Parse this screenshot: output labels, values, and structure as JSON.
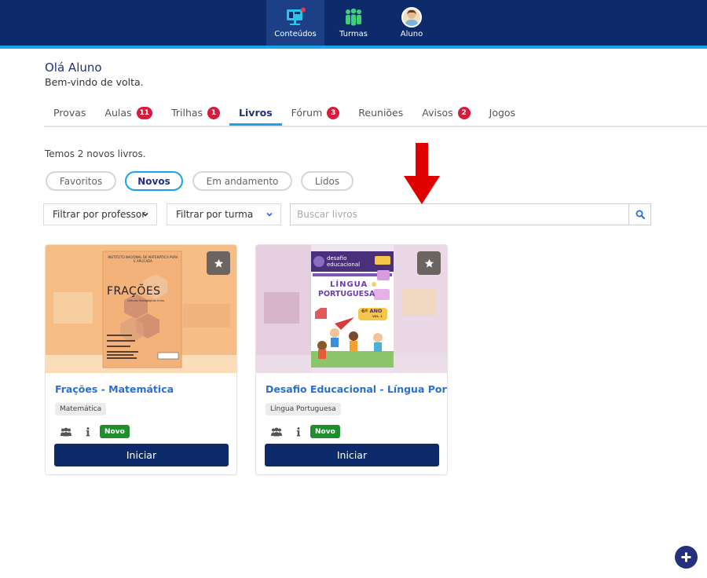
{
  "topnav": {
    "items": [
      {
        "label": "Conteúdos",
        "icon": "monitor-icon",
        "active": true
      },
      {
        "label": "Turmas",
        "icon": "group-icon",
        "active": false
      },
      {
        "label": "Aluno",
        "icon": "avatar",
        "active": false
      }
    ]
  },
  "greeting": {
    "title": "Olá Aluno",
    "subtitle": "Bem-vindo de volta."
  },
  "tabs": [
    {
      "label": "Provas",
      "badge": null
    },
    {
      "label": "Aulas",
      "badge": "11"
    },
    {
      "label": "Trilhas",
      "badge": "1"
    },
    {
      "label": "Livros",
      "badge": null,
      "active": true
    },
    {
      "label": "Fórum",
      "badge": "3"
    },
    {
      "label": "Reuniões",
      "badge": null
    },
    {
      "label": "Avisos",
      "badge": "2"
    },
    {
      "label": "Jogos",
      "badge": null
    }
  ],
  "news_text": "Temos 2 novos livros.",
  "filters": {
    "chips": [
      {
        "label": "Favoritos",
        "selected": false
      },
      {
        "label": "Novos",
        "selected": true
      },
      {
        "label": "Em andamento",
        "selected": false
      },
      {
        "label": "Lidos",
        "selected": false
      }
    ],
    "professor": "Filtrar por professor",
    "turma": "Filtrar por turma",
    "search_placeholder": "Buscar livros"
  },
  "books": [
    {
      "title": "Frações - Matemática",
      "tag": "Matemática",
      "status": "Novo",
      "button": "Iniciar",
      "cover": {
        "header": "INSTITUTO NACIONAL DE MATEMÁTICA PURA E APLICADA",
        "title": "FRAÇÕES",
        "subtitle": "Leituras Pedagógicas Impa"
      }
    },
    {
      "title": "Desafio Educacional - Língua Portu...",
      "tag": "Língua Portuguesa",
      "status": "Novo",
      "button": "Iniciar",
      "cover": {
        "brand_line1": "desafio",
        "brand_line2": "educacional",
        "title_line1": "LÍNGUA",
        "title_line2": "PORTUGUESA",
        "grade": "6º ANO",
        "volume": "VOL. 1"
      }
    }
  ],
  "colors": {
    "topbar": "#0d2a6b",
    "accent": "#1aa3e8",
    "badge": "#d81b3c",
    "title_link": "#2a6fd6",
    "new_badge": "#1f8f2e",
    "button": "#0d2a6b",
    "annotation_arrow": "#e00000"
  }
}
